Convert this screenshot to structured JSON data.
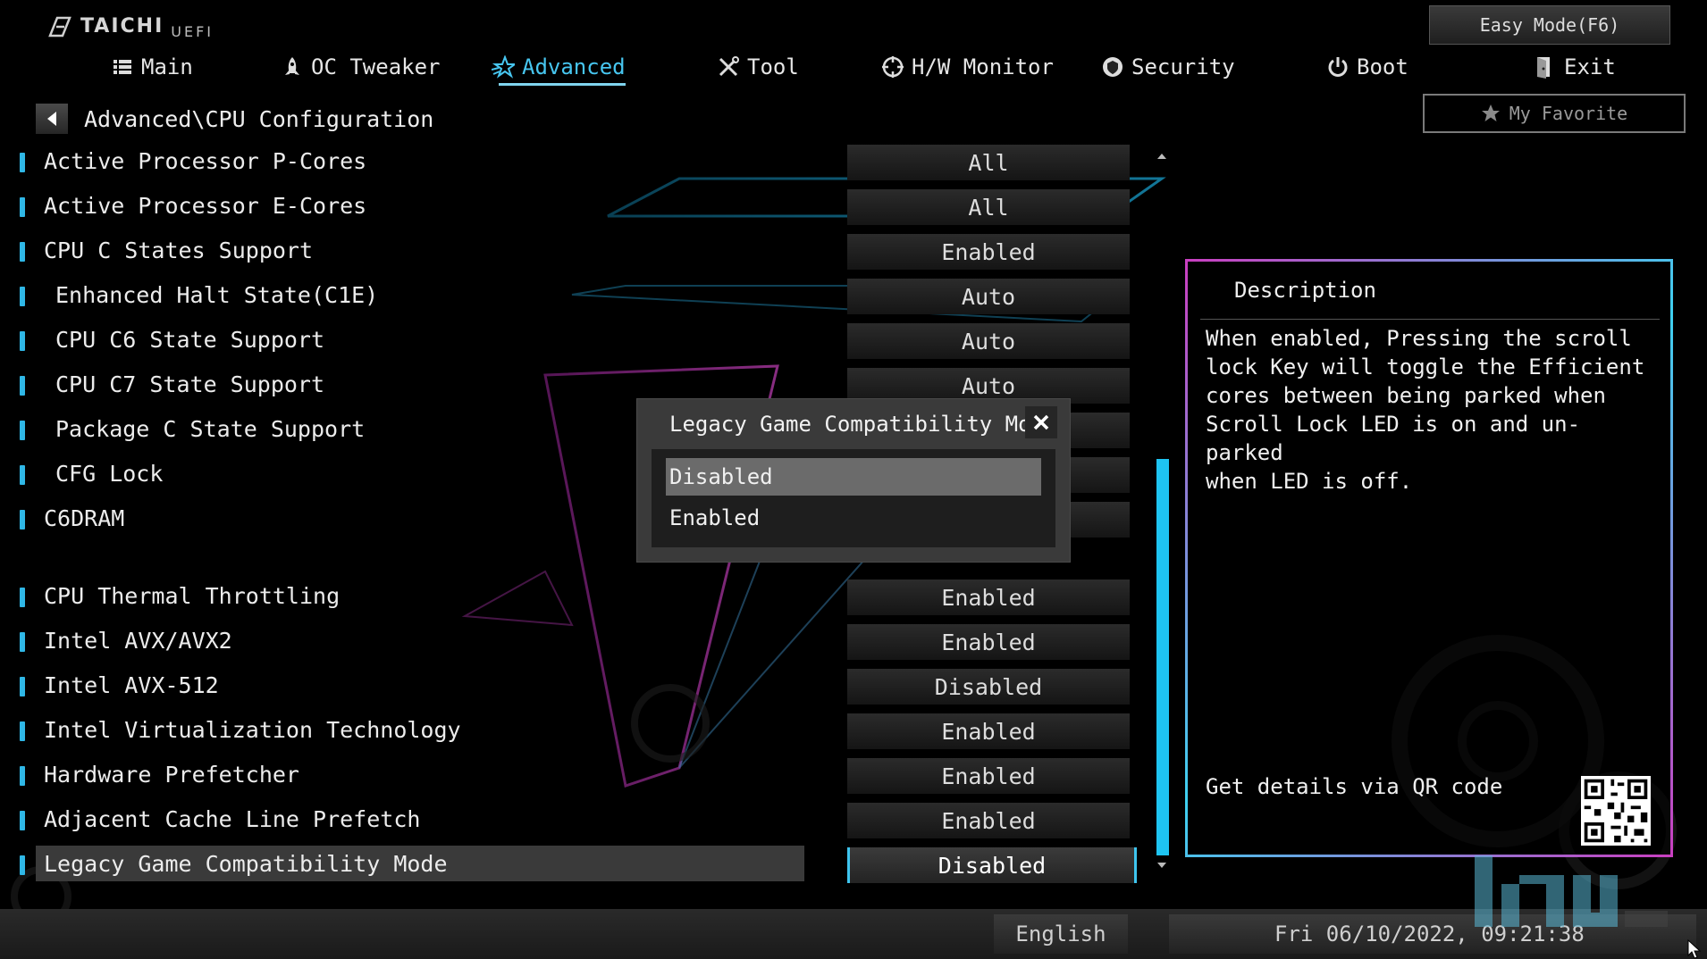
{
  "app": {
    "brand": "TAICHI",
    "subbrand": "UEFI"
  },
  "easy_mode_label": "Easy Mode(F6)",
  "tabs": [
    {
      "label": "Main",
      "icon": "list-icon",
      "active": false
    },
    {
      "label": "OC Tweaker",
      "icon": "rocket-icon",
      "active": false
    },
    {
      "label": "Advanced",
      "icon": "star-icon",
      "active": true
    },
    {
      "label": "Tool",
      "icon": "tools-icon",
      "active": false
    },
    {
      "label": "H/W Monitor",
      "icon": "crosshair-icon",
      "active": false
    },
    {
      "label": "Security",
      "icon": "shield-icon",
      "active": false
    },
    {
      "label": "Boot",
      "icon": "power-icon",
      "active": false
    },
    {
      "label": "Exit",
      "icon": "exit-door-icon",
      "active": false
    }
  ],
  "breadcrumb": "Advanced\\CPU Configuration",
  "favorite_label": "My Favorite",
  "settings": [
    {
      "label": "Active Processor P-Cores",
      "value": "All"
    },
    {
      "label": "Active Processor E-Cores",
      "value": "All"
    },
    {
      "label": "CPU C States Support",
      "value": "Enabled"
    },
    {
      "label": "Enhanced Halt State(C1E)",
      "value": "Auto"
    },
    {
      "label": "CPU C6 State Support",
      "value": "Auto"
    },
    {
      "label": "CPU C7 State Support",
      "value": "Auto"
    },
    {
      "label": "Package C State Support",
      "value": ""
    },
    {
      "label": "CFG Lock",
      "value": ""
    },
    {
      "label": "C6DRAM",
      "value": ""
    },
    {
      "label": "CPU Thermal Throttling",
      "value": "Enabled"
    },
    {
      "label": "Intel AVX/AVX2",
      "value": "Enabled"
    },
    {
      "label": "Intel AVX-512",
      "value": "Disabled"
    },
    {
      "label": "Intel Virtualization Technology",
      "value": "Enabled"
    },
    {
      "label": "Hardware Prefetcher",
      "value": "Enabled"
    },
    {
      "label": "Adjacent Cache Line Prefetch",
      "value": "Enabled"
    },
    {
      "label": "Legacy Game Compatibility Mode",
      "value": "Disabled"
    }
  ],
  "description": {
    "title": "Description",
    "text": "When enabled, Pressing the scroll\nlock Key will toggle the Efficient\ncores between being parked when\nScroll Lock LED is on and un-parked\nwhen LED is off.",
    "qr_label": "Get details via QR code"
  },
  "dialog": {
    "title": "Legacy Game Compatibility Mode",
    "options": [
      "Disabled",
      "Enabled"
    ],
    "selected": "Disabled"
  },
  "footer": {
    "language": "English",
    "datetime": "Fri 06/10/2022, 09:21:38"
  },
  "colors": {
    "accent": "#2fb7e6",
    "active_tab": "#47c6f0",
    "frame_pink": "#c93fc0"
  }
}
